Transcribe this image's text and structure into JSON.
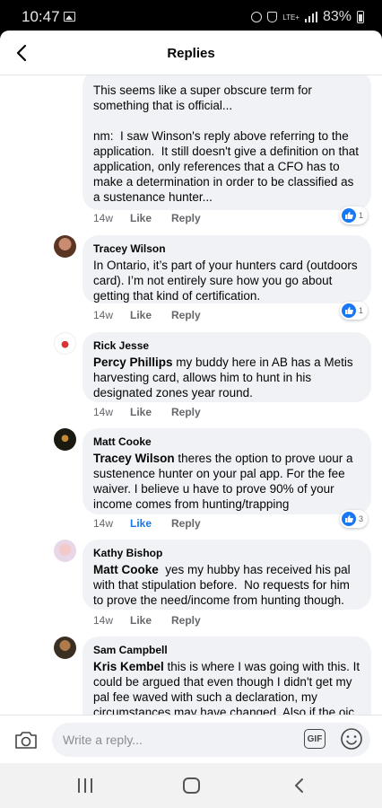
{
  "status_bar": {
    "time": "10:47",
    "network": "LTE+",
    "battery": "83%"
  },
  "header": {
    "title": "Replies"
  },
  "comments": [
    {
      "author": "",
      "mention": "",
      "text": "This seems like a super obscure term for something that is official...\n\nnm:  I saw Winson's reply above referring to the application.  It still doesn't give a definition on that application, only references that a CFO has to make a determination in order to be classified as a sustenance hunter...",
      "time": "14w",
      "like": "Like",
      "reply": "Reply",
      "reactions": "1",
      "liked": false
    },
    {
      "author": "Tracey Wilson",
      "mention": "",
      "text": "In Ontario, it’s part of your hunters card (outdoors card). I’m not entirely sure how you go about getting that kind of certification.",
      "time": "14w",
      "like": "Like",
      "reply": "Reply",
      "reactions": "1",
      "liked": false
    },
    {
      "author": "Rick Jesse",
      "mention": "Percy Phillips",
      "text": " my buddy here in AB has a Metis harvesting card, allows him to hunt in his designated zones year round.",
      "time": "14w",
      "like": "Like",
      "reply": "Reply",
      "reactions": "",
      "liked": false
    },
    {
      "author": "Matt Cooke",
      "mention": "Tracey Wilson",
      "text": " theres the option to prove uour a sustenence hunter on your pal app. For the fee waiver. I believe u have to prove 90% of your income comes from hunting/trapping",
      "time": "14w",
      "like": "Like",
      "reply": "Reply",
      "reactions": "3",
      "liked": true
    },
    {
      "author": "Kathy Bishop",
      "mention": "Matt Cooke",
      "text": "  yes my hubby has received his pal with that stipulation before.  No requests for him to prove the need/income from hunting though.",
      "time": "14w",
      "like": "Like",
      "reply": "Reply",
      "reactions": "",
      "liked": false
    },
    {
      "author": "Sam Campbell",
      "mention": "Kris Kembel",
      "text": " this is where I was going with this. It could be argued that even though I didn't get my pal fee waved with such a declaration, my circumstances may have changed. Also if the oic",
      "time": "",
      "like": "",
      "reply": "",
      "reactions": "",
      "liked": false
    }
  ],
  "reply_bar": {
    "placeholder": "Write a reply...",
    "gif_label": "GIF"
  },
  "colors": {
    "accent": "#1877f2",
    "bubble": "#f0f2f5",
    "meta": "#65676b"
  },
  "icons": [
    "back-arrow-icon",
    "camera-icon",
    "gif-icon",
    "emoji-icon",
    "like-thumb-icon"
  ]
}
